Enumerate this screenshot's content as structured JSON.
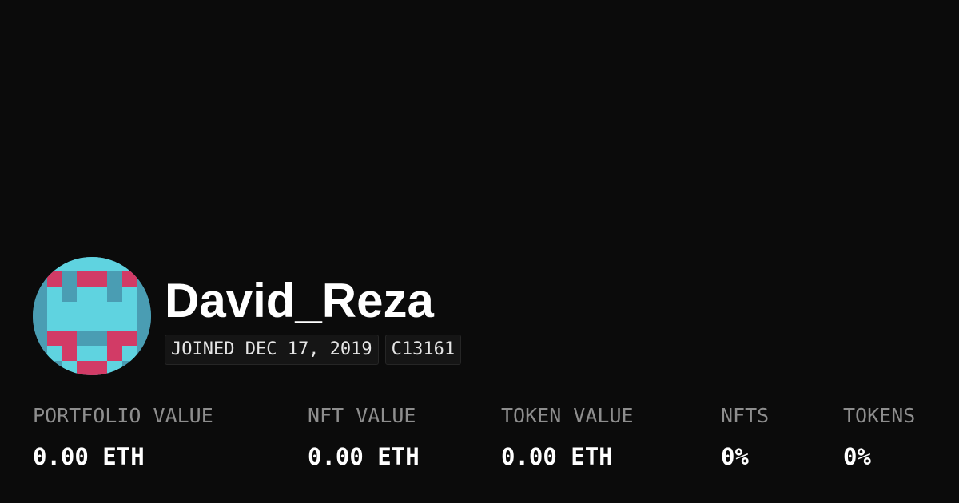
{
  "profile": {
    "username": "David_Reza",
    "joined": "JOINED DEC 17, 2019",
    "id_badge": "C13161"
  },
  "stats": [
    {
      "label": "PORTFOLIO VALUE",
      "value": "0.00 ETH"
    },
    {
      "label": "NFT VALUE",
      "value": "0.00 ETH"
    },
    {
      "label": "TOKEN VALUE",
      "value": "0.00 ETH"
    },
    {
      "label": "NFTS",
      "value": "0%"
    },
    {
      "label": "TOKENS",
      "value": "0%"
    }
  ],
  "colors": {
    "background": "#0b0b0b",
    "text": "#ffffff",
    "muted": "#8e8e8e",
    "avatar_teal": "#4a9db3",
    "avatar_cyan": "#5fd3e0",
    "avatar_pink": "#d23b66"
  },
  "avatar": {
    "icon": "pixel-identicon"
  }
}
